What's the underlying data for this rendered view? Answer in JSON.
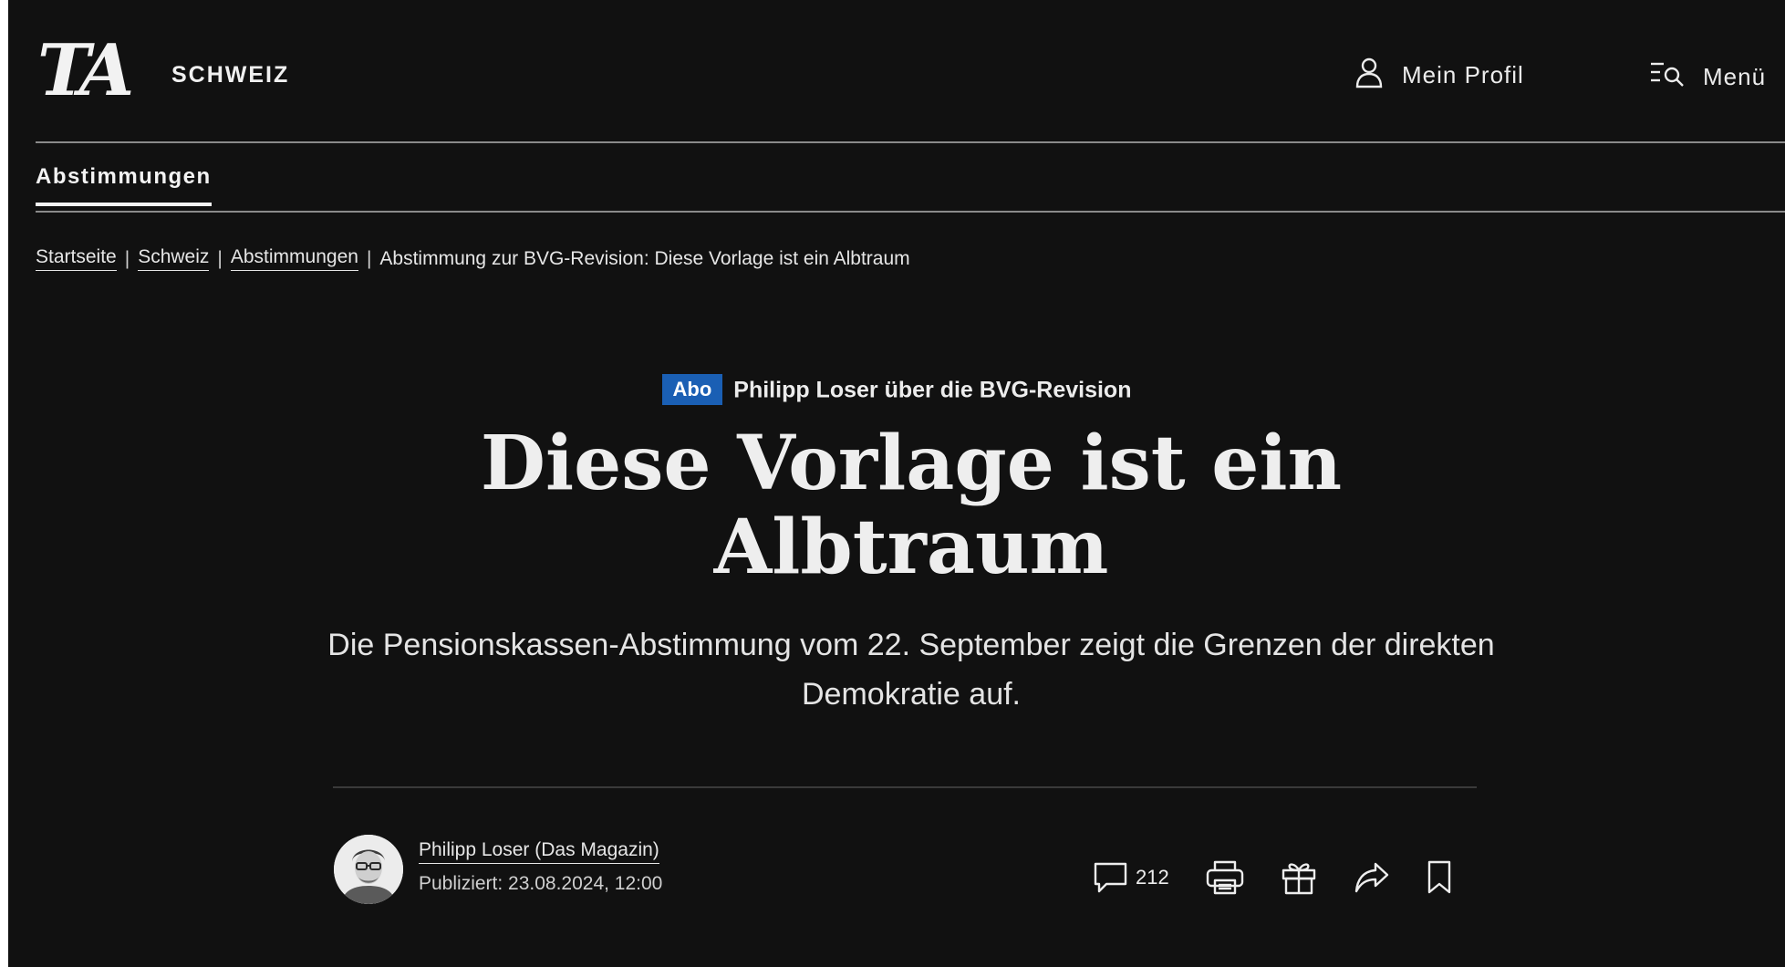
{
  "header": {
    "logo_text": "TA",
    "section": "SCHWEIZ",
    "profile_label": "Mein Profil",
    "menu_label": "Menü"
  },
  "subnav": {
    "active_item": "Abstimmungen"
  },
  "breadcrumb": {
    "items": [
      "Startseite",
      "Schweiz",
      "Abstimmungen"
    ],
    "current": "Abstimmung zur BVG-Revision: Diese Vorlage ist ein Albtraum",
    "separator": "|"
  },
  "article": {
    "badge": "Abo",
    "kicker": "Philipp Loser über die BVG-Revision",
    "headline": "Diese Vorlage ist ein Albtraum",
    "lead": "Die Pensionskassen-Abstimmung vom 22. September zeigt die Grenzen der direkten Demokratie auf.",
    "author": "Philipp Loser (Das Magazin)",
    "published": "Publiziert: 23.08.2024, 12:00",
    "comment_count": "212"
  },
  "colors": {
    "background": "#111111",
    "text": "#eeeeee",
    "badge": "#1a5fb4"
  },
  "icons": {
    "profile": "person-icon",
    "menu": "menu-search-icon",
    "comments": "comment-icon",
    "print": "print-icon",
    "gift": "gift-icon",
    "share": "share-icon",
    "bookmark": "bookmark-icon"
  }
}
